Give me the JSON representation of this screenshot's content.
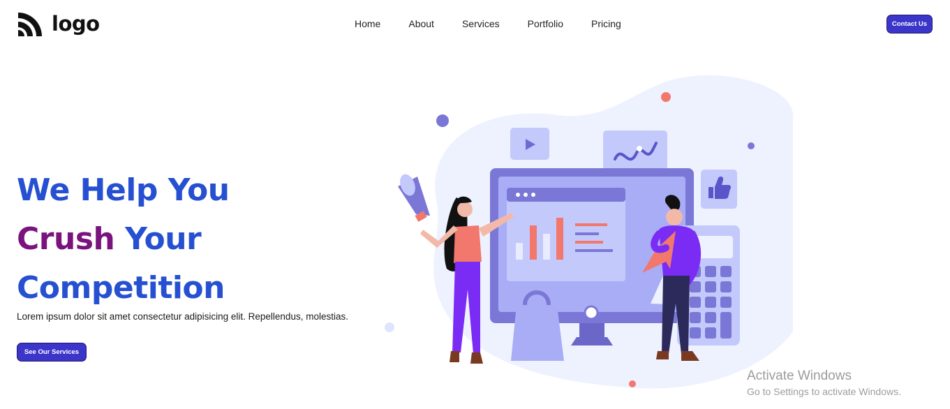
{
  "header": {
    "logo_text": "logo",
    "nav": [
      "Home",
      "About",
      "Services",
      "Portfolio",
      "Pricing"
    ],
    "contact_label": "Contact Us"
  },
  "hero": {
    "line1": "We Help You",
    "line2_accent": "Crush",
    "line2_rest": " Your",
    "line3": "Competition",
    "description": "Lorem ipsum dolor sit amet consectetur adipisicing elit. Repellendus, molestias.",
    "cta_label": "See Our Services"
  },
  "illustration": {
    "icons": [
      "megaphone-icon",
      "play-icon",
      "chart-icon",
      "thumbs-up-icon",
      "calculator-icon",
      "shopping-bag-icon"
    ]
  },
  "colors": {
    "primary": "#2650d1",
    "accent": "#7a137e",
    "button": "#3b35c9",
    "illustration_purple": "#7b77d6",
    "illustration_pink": "#f2776d"
  },
  "watermark": {
    "title": "Activate Windows",
    "subtitle": "Go to Settings to activate Windows."
  }
}
